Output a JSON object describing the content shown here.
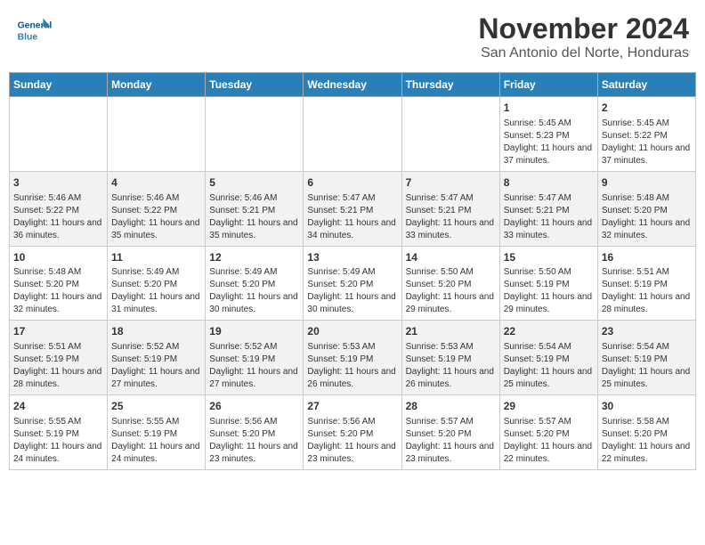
{
  "header": {
    "logo_line1": "General",
    "logo_line2": "Blue",
    "title": "November 2024",
    "subtitle": "San Antonio del Norte, Honduras"
  },
  "weekdays": [
    "Sunday",
    "Monday",
    "Tuesday",
    "Wednesday",
    "Thursday",
    "Friday",
    "Saturday"
  ],
  "weeks": [
    [
      {
        "day": "",
        "info": ""
      },
      {
        "day": "",
        "info": ""
      },
      {
        "day": "",
        "info": ""
      },
      {
        "day": "",
        "info": ""
      },
      {
        "day": "",
        "info": ""
      },
      {
        "day": "1",
        "info": "Sunrise: 5:45 AM\nSunset: 5:23 PM\nDaylight: 11 hours and 37 minutes."
      },
      {
        "day": "2",
        "info": "Sunrise: 5:45 AM\nSunset: 5:22 PM\nDaylight: 11 hours and 37 minutes."
      }
    ],
    [
      {
        "day": "3",
        "info": "Sunrise: 5:46 AM\nSunset: 5:22 PM\nDaylight: 11 hours and 36 minutes."
      },
      {
        "day": "4",
        "info": "Sunrise: 5:46 AM\nSunset: 5:22 PM\nDaylight: 11 hours and 35 minutes."
      },
      {
        "day": "5",
        "info": "Sunrise: 5:46 AM\nSunset: 5:21 PM\nDaylight: 11 hours and 35 minutes."
      },
      {
        "day": "6",
        "info": "Sunrise: 5:47 AM\nSunset: 5:21 PM\nDaylight: 11 hours and 34 minutes."
      },
      {
        "day": "7",
        "info": "Sunrise: 5:47 AM\nSunset: 5:21 PM\nDaylight: 11 hours and 33 minutes."
      },
      {
        "day": "8",
        "info": "Sunrise: 5:47 AM\nSunset: 5:21 PM\nDaylight: 11 hours and 33 minutes."
      },
      {
        "day": "9",
        "info": "Sunrise: 5:48 AM\nSunset: 5:20 PM\nDaylight: 11 hours and 32 minutes."
      }
    ],
    [
      {
        "day": "10",
        "info": "Sunrise: 5:48 AM\nSunset: 5:20 PM\nDaylight: 11 hours and 32 minutes."
      },
      {
        "day": "11",
        "info": "Sunrise: 5:49 AM\nSunset: 5:20 PM\nDaylight: 11 hours and 31 minutes."
      },
      {
        "day": "12",
        "info": "Sunrise: 5:49 AM\nSunset: 5:20 PM\nDaylight: 11 hours and 30 minutes."
      },
      {
        "day": "13",
        "info": "Sunrise: 5:49 AM\nSunset: 5:20 PM\nDaylight: 11 hours and 30 minutes."
      },
      {
        "day": "14",
        "info": "Sunrise: 5:50 AM\nSunset: 5:20 PM\nDaylight: 11 hours and 29 minutes."
      },
      {
        "day": "15",
        "info": "Sunrise: 5:50 AM\nSunset: 5:19 PM\nDaylight: 11 hours and 29 minutes."
      },
      {
        "day": "16",
        "info": "Sunrise: 5:51 AM\nSunset: 5:19 PM\nDaylight: 11 hours and 28 minutes."
      }
    ],
    [
      {
        "day": "17",
        "info": "Sunrise: 5:51 AM\nSunset: 5:19 PM\nDaylight: 11 hours and 28 minutes."
      },
      {
        "day": "18",
        "info": "Sunrise: 5:52 AM\nSunset: 5:19 PM\nDaylight: 11 hours and 27 minutes."
      },
      {
        "day": "19",
        "info": "Sunrise: 5:52 AM\nSunset: 5:19 PM\nDaylight: 11 hours and 27 minutes."
      },
      {
        "day": "20",
        "info": "Sunrise: 5:53 AM\nSunset: 5:19 PM\nDaylight: 11 hours and 26 minutes."
      },
      {
        "day": "21",
        "info": "Sunrise: 5:53 AM\nSunset: 5:19 PM\nDaylight: 11 hours and 26 minutes."
      },
      {
        "day": "22",
        "info": "Sunrise: 5:54 AM\nSunset: 5:19 PM\nDaylight: 11 hours and 25 minutes."
      },
      {
        "day": "23",
        "info": "Sunrise: 5:54 AM\nSunset: 5:19 PM\nDaylight: 11 hours and 25 minutes."
      }
    ],
    [
      {
        "day": "24",
        "info": "Sunrise: 5:55 AM\nSunset: 5:19 PM\nDaylight: 11 hours and 24 minutes."
      },
      {
        "day": "25",
        "info": "Sunrise: 5:55 AM\nSunset: 5:19 PM\nDaylight: 11 hours and 24 minutes."
      },
      {
        "day": "26",
        "info": "Sunrise: 5:56 AM\nSunset: 5:20 PM\nDaylight: 11 hours and 23 minutes."
      },
      {
        "day": "27",
        "info": "Sunrise: 5:56 AM\nSunset: 5:20 PM\nDaylight: 11 hours and 23 minutes."
      },
      {
        "day": "28",
        "info": "Sunrise: 5:57 AM\nSunset: 5:20 PM\nDaylight: 11 hours and 23 minutes."
      },
      {
        "day": "29",
        "info": "Sunrise: 5:57 AM\nSunset: 5:20 PM\nDaylight: 11 hours and 22 minutes."
      },
      {
        "day": "30",
        "info": "Sunrise: 5:58 AM\nSunset: 5:20 PM\nDaylight: 11 hours and 22 minutes."
      }
    ]
  ]
}
